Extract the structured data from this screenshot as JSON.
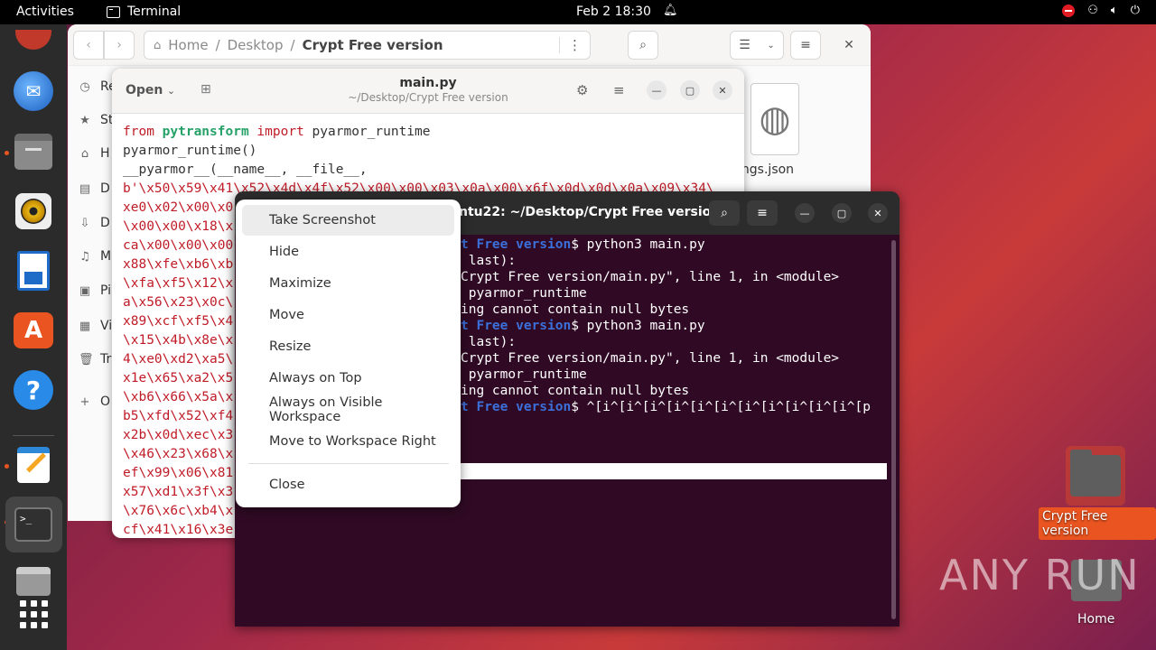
{
  "topbar": {
    "activities": "Activities",
    "app_name": "Terminal",
    "clock": "Feb 2  18:30"
  },
  "files": {
    "path": [
      "Home",
      "Desktop",
      "Crypt Free version"
    ],
    "sidebar": [
      "Re",
      "St",
      "H",
      "D",
      "D",
      "M",
      "Pi",
      "Vi",
      "Tr",
      "O"
    ],
    "file_label": "ngs.json"
  },
  "editor": {
    "open_label": "Open",
    "title": "main.py",
    "subtitle": "~/Desktop/Crypt Free version",
    "lines": [
      "pyarmor_runtime()",
      "__pyarmor__(__name__, __file__,",
      "b'\\x50\\x59\\x41\\x52\\x4d\\x4f\\x52\\x00\\x00\\x03\\x0a\\x00\\x6f\\x0d\\x0d\\x0a\\x09\\x34\\",
      "xe0\\x02\\x00\\x0",
      "\\x00\\x00\\x18\\x",
      "ca\\x00\\x00\\x00",
      "x88\\xfe\\xb6\\xb",
      "\\xfa\\xf5\\x12\\x",
      "a\\x56\\x23\\x0c\\",
      "x89\\xcf\\xf5\\x4",
      "\\x15\\x4b\\x8e\\x",
      "4\\xe0\\xd2\\xa5\\",
      "x1e\\x65\\xa2\\x5",
      "\\xb6\\x66\\x5a\\x",
      "b5\\xfd\\x52\\xf4",
      "x2b\\x0d\\xec\\x3",
      "\\x46\\x23\\x68\\x",
      "ef\\x99\\x06\\x81",
      "x57\\xd1\\x3f\\x3",
      "\\x76\\x6c\\xb4\\x",
      "cf\\x41\\x16\\x3e"
    ],
    "first_line": {
      "kw1": "from",
      "mod": "pytransform",
      "kw2": "import",
      "rest": "pyarmor_runtime"
    }
  },
  "terminal": {
    "title": "ntu22: ~/Desktop/Crypt Free version",
    "prompt_frag": "t Free version",
    "cmd1": "$ python3 main.py",
    "l2": " last):",
    "l3": "Crypt Free version/main.py\", line 1, in <module>",
    "l4": " pyarmor_runtime",
    "l5": "ing cannot contain null bytes",
    "cmd2": "$ python3 main.py",
    "l7": " last):",
    "l8": "Crypt Free version/main.py\", line 1, in <module>",
    "l9": " pyarmor_runtime",
    "l10": "ing cannot contain null bytes",
    "cmd3": "$ ^[i^[i^[i^[i^[i^[i^[i^[i^[i^[i^[i^[p"
  },
  "context_menu": {
    "items": [
      "Take Screenshot",
      "Hide",
      "Maximize",
      "Move",
      "Resize",
      "Always on Top",
      "Always on Visible Workspace",
      "Move to Workspace Right"
    ],
    "close": "Close"
  },
  "desktop": {
    "folder_label": "Crypt Free version",
    "home_label": "Home",
    "watermark": "ANY RUN"
  },
  "colors": {
    "ubuntu_orange": "#e95420",
    "terminal_bg": "#300a24"
  }
}
